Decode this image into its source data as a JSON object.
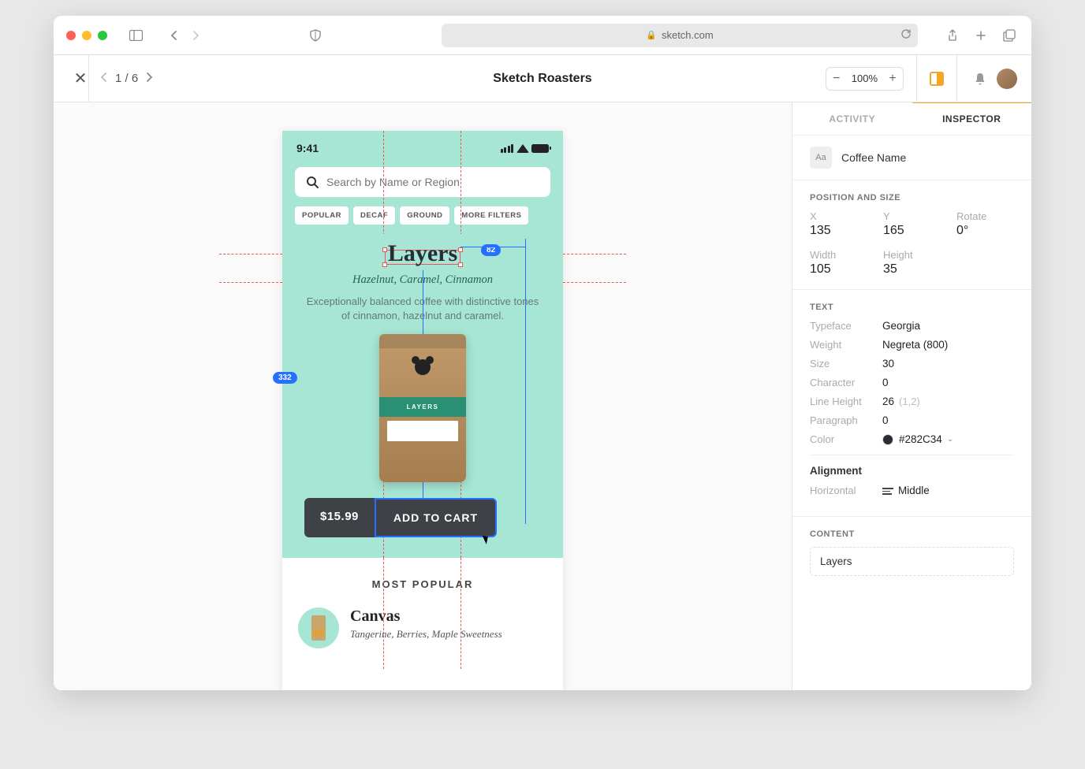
{
  "browser": {
    "url": "sketch.com"
  },
  "app": {
    "project_title": "Sketch Roasters",
    "page_current": "1",
    "page_total": "6",
    "zoom": "100%"
  },
  "artboard": {
    "status_time": "9:41",
    "search_placeholder": "Search by Name or Region",
    "filters": [
      "POPULAR",
      "DECAF",
      "GROUND",
      "MORE FILTERS"
    ],
    "product": {
      "title": "Layers",
      "subtitle": "Hazelnut, Caramel, Cinnamon",
      "description": "Exceptionally balanced coffee with distinctive tones of cinnamon, hazelnut and caramel.",
      "bag_label": "LAYERS",
      "price": "$15.99",
      "cart_label": "ADD TO CART"
    },
    "measure_82": "82",
    "measure_332": "332",
    "popular": {
      "heading": "MOST POPULAR",
      "item1_name": "Canvas",
      "item1_sub": "Tangerine, Berries, Maple Sweetness"
    }
  },
  "inspector": {
    "tab_activity": "ACTIVITY",
    "tab_inspector": "INSPECTOR",
    "layer_icon": "Aa",
    "layer_name": "Coffee Name",
    "position_heading": "POSITION AND SIZE",
    "x_label": "X",
    "x_value": "135",
    "y_label": "Y",
    "y_value": "165",
    "rotate_label": "Rotate",
    "rotate_value": "0°",
    "w_label": "Width",
    "w_value": "105",
    "h_label": "Height",
    "h_value": "35",
    "text_heading": "TEXT",
    "typeface_label": "Typeface",
    "typeface_value": "Georgia",
    "weight_label": "Weight",
    "weight_value": "Negreta (800)",
    "size_label": "Size",
    "size_value": "30",
    "char_label": "Character",
    "char_value": "0",
    "lh_label": "Line Height",
    "lh_value": "26",
    "lh_sub": "(1,2)",
    "para_label": "Paragraph",
    "para_value": "0",
    "color_label": "Color",
    "color_value": "#282C34",
    "align_heading": "Alignment",
    "horiz_label": "Horizontal",
    "horiz_value": "Middle",
    "content_heading": "CONTENT",
    "content_value": "Layers"
  }
}
